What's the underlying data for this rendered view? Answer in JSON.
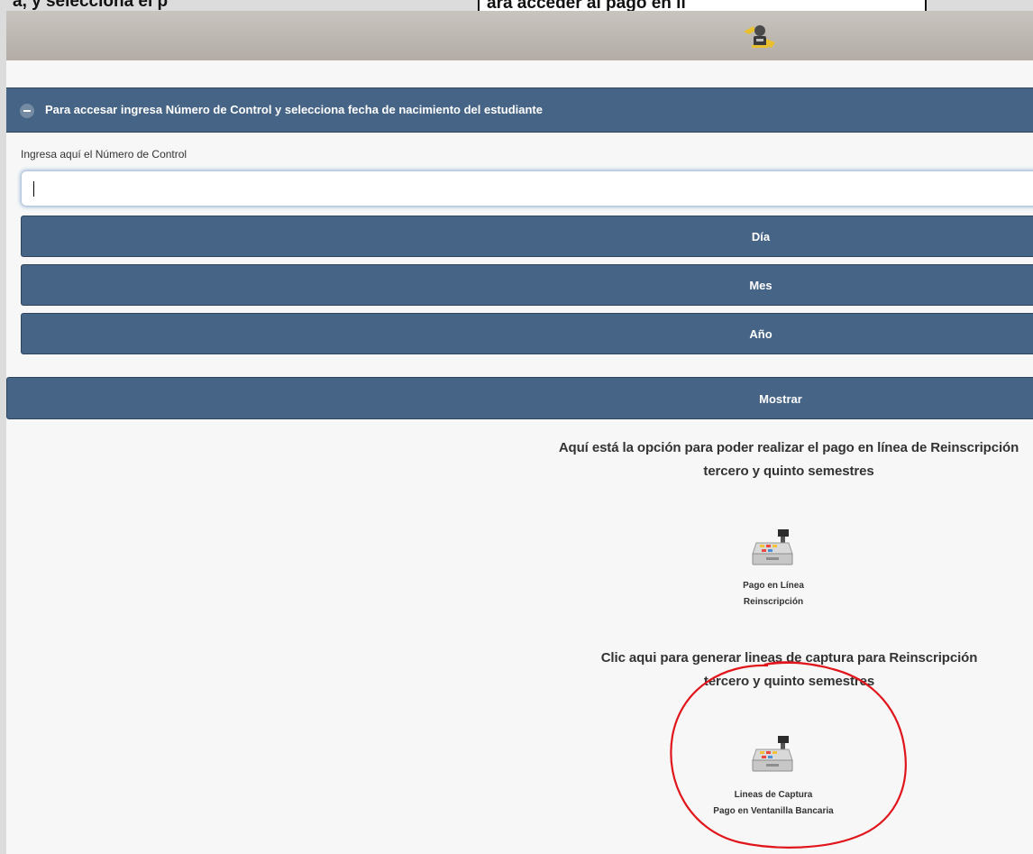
{
  "caption": {
    "left_text": "a, y selecciona el p",
    "boxed_text": "ara acceder al pago en lí"
  },
  "header": {
    "logo_icon": "student-logo-icon"
  },
  "login_panel": {
    "title": "Para accesar ingresa Número de Control y selecciona fecha de nacimiento del estudiante",
    "control_label": "Ingresa aquí el Número de Control",
    "control_value": "",
    "day_label": "Día",
    "month_label": "Mes",
    "year_label": "Año",
    "show_button": "Mostrar"
  },
  "online_payment": {
    "line1": "Aquí está la opción para poder realizar el pago en línea de Reinscripción",
    "line2": "tercero y quinto semestres",
    "tile_line1": "Pago en Línea",
    "tile_line2": "Reinscripción",
    "tile_icon": "cash-register-icon"
  },
  "capture_lines": {
    "line1": "Clic aqui para generar lineas de captura para Reinscripción",
    "line2": "tercero y quinto semestres",
    "tile_line1": "Lineas de Captura",
    "tile_line2": "Pago en Ventanilla Bancaria",
    "tile_icon": "cash-register-icon"
  },
  "colors": {
    "panel_blue": "#466485",
    "annotation_red": "#e0161c",
    "header_gray": "#b3aca6"
  }
}
